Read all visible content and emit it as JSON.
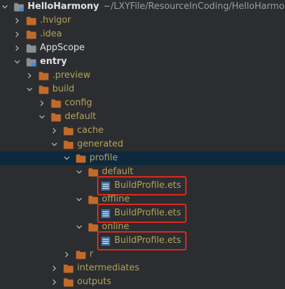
{
  "colors": {
    "background": "#2b2d30",
    "selection": "#0d293e",
    "excluded_text": "#b3a35a",
    "normal_text": "#dfe1e5",
    "folder_orange": "#c36a2b",
    "folder_gray": "#8c8f94",
    "highlight_box": "#e0291f"
  },
  "tree": {
    "root": {
      "name": "HelloHarmony",
      "path": "~/LXYFile/ResourceInCoding/HelloHarmony"
    },
    "items": [
      {
        "label": "HelloHarmony",
        "depth": 0,
        "icon": "module-folder-icon",
        "expanded": true,
        "text": "bold"
      },
      {
        "label": ".hvigor",
        "depth": 1,
        "icon": "folder-icon",
        "expanded": false,
        "text": "excluded"
      },
      {
        "label": ".idea",
        "depth": 1,
        "icon": "folder-icon",
        "expanded": false,
        "text": "excluded"
      },
      {
        "label": "AppScope",
        "depth": 1,
        "icon": "folder-icon",
        "expanded": false,
        "text": "normal"
      },
      {
        "label": "entry",
        "depth": 1,
        "icon": "module-folder-icon",
        "expanded": true,
        "text": "bold"
      },
      {
        "label": ".preview",
        "depth": 2,
        "icon": "folder-icon",
        "expanded": false,
        "text": "excluded"
      },
      {
        "label": "build",
        "depth": 2,
        "icon": "folder-icon",
        "expanded": true,
        "text": "excluded"
      },
      {
        "label": "config",
        "depth": 3,
        "icon": "folder-icon",
        "expanded": false,
        "text": "excluded"
      },
      {
        "label": "default",
        "depth": 3,
        "icon": "folder-icon",
        "expanded": true,
        "text": "excluded"
      },
      {
        "label": "cache",
        "depth": 4,
        "icon": "folder-icon",
        "expanded": false,
        "text": "excluded"
      },
      {
        "label": "generated",
        "depth": 4,
        "icon": "folder-icon",
        "expanded": true,
        "text": "excluded"
      },
      {
        "label": "profile",
        "depth": 5,
        "icon": "folder-icon",
        "expanded": true,
        "text": "excluded",
        "selected": true
      },
      {
        "label": "default",
        "depth": 6,
        "icon": "folder-icon",
        "expanded": true,
        "text": "excluded"
      },
      {
        "label": "BuildProfile.ets",
        "depth": 7,
        "icon": "ets-file-icon",
        "text": "excluded",
        "highlighted": true
      },
      {
        "label": "offline",
        "depth": 6,
        "icon": "folder-icon",
        "expanded": true,
        "text": "excluded"
      },
      {
        "label": "BuildProfile.ets",
        "depth": 7,
        "icon": "ets-file-icon",
        "text": "excluded",
        "highlighted": true
      },
      {
        "label": "online",
        "depth": 6,
        "icon": "folder-icon",
        "expanded": true,
        "text": "excluded"
      },
      {
        "label": "BuildProfile.ets",
        "depth": 7,
        "icon": "ets-file-icon",
        "text": "excluded",
        "highlighted": true
      },
      {
        "label": "r",
        "depth": 5,
        "icon": "folder-icon",
        "expanded": false,
        "text": "excluded"
      },
      {
        "label": "intermediates",
        "depth": 4,
        "icon": "folder-icon",
        "expanded": false,
        "text": "excluded"
      },
      {
        "label": "outputs",
        "depth": 4,
        "icon": "folder-icon",
        "expanded": false,
        "text": "excluded"
      }
    ]
  }
}
